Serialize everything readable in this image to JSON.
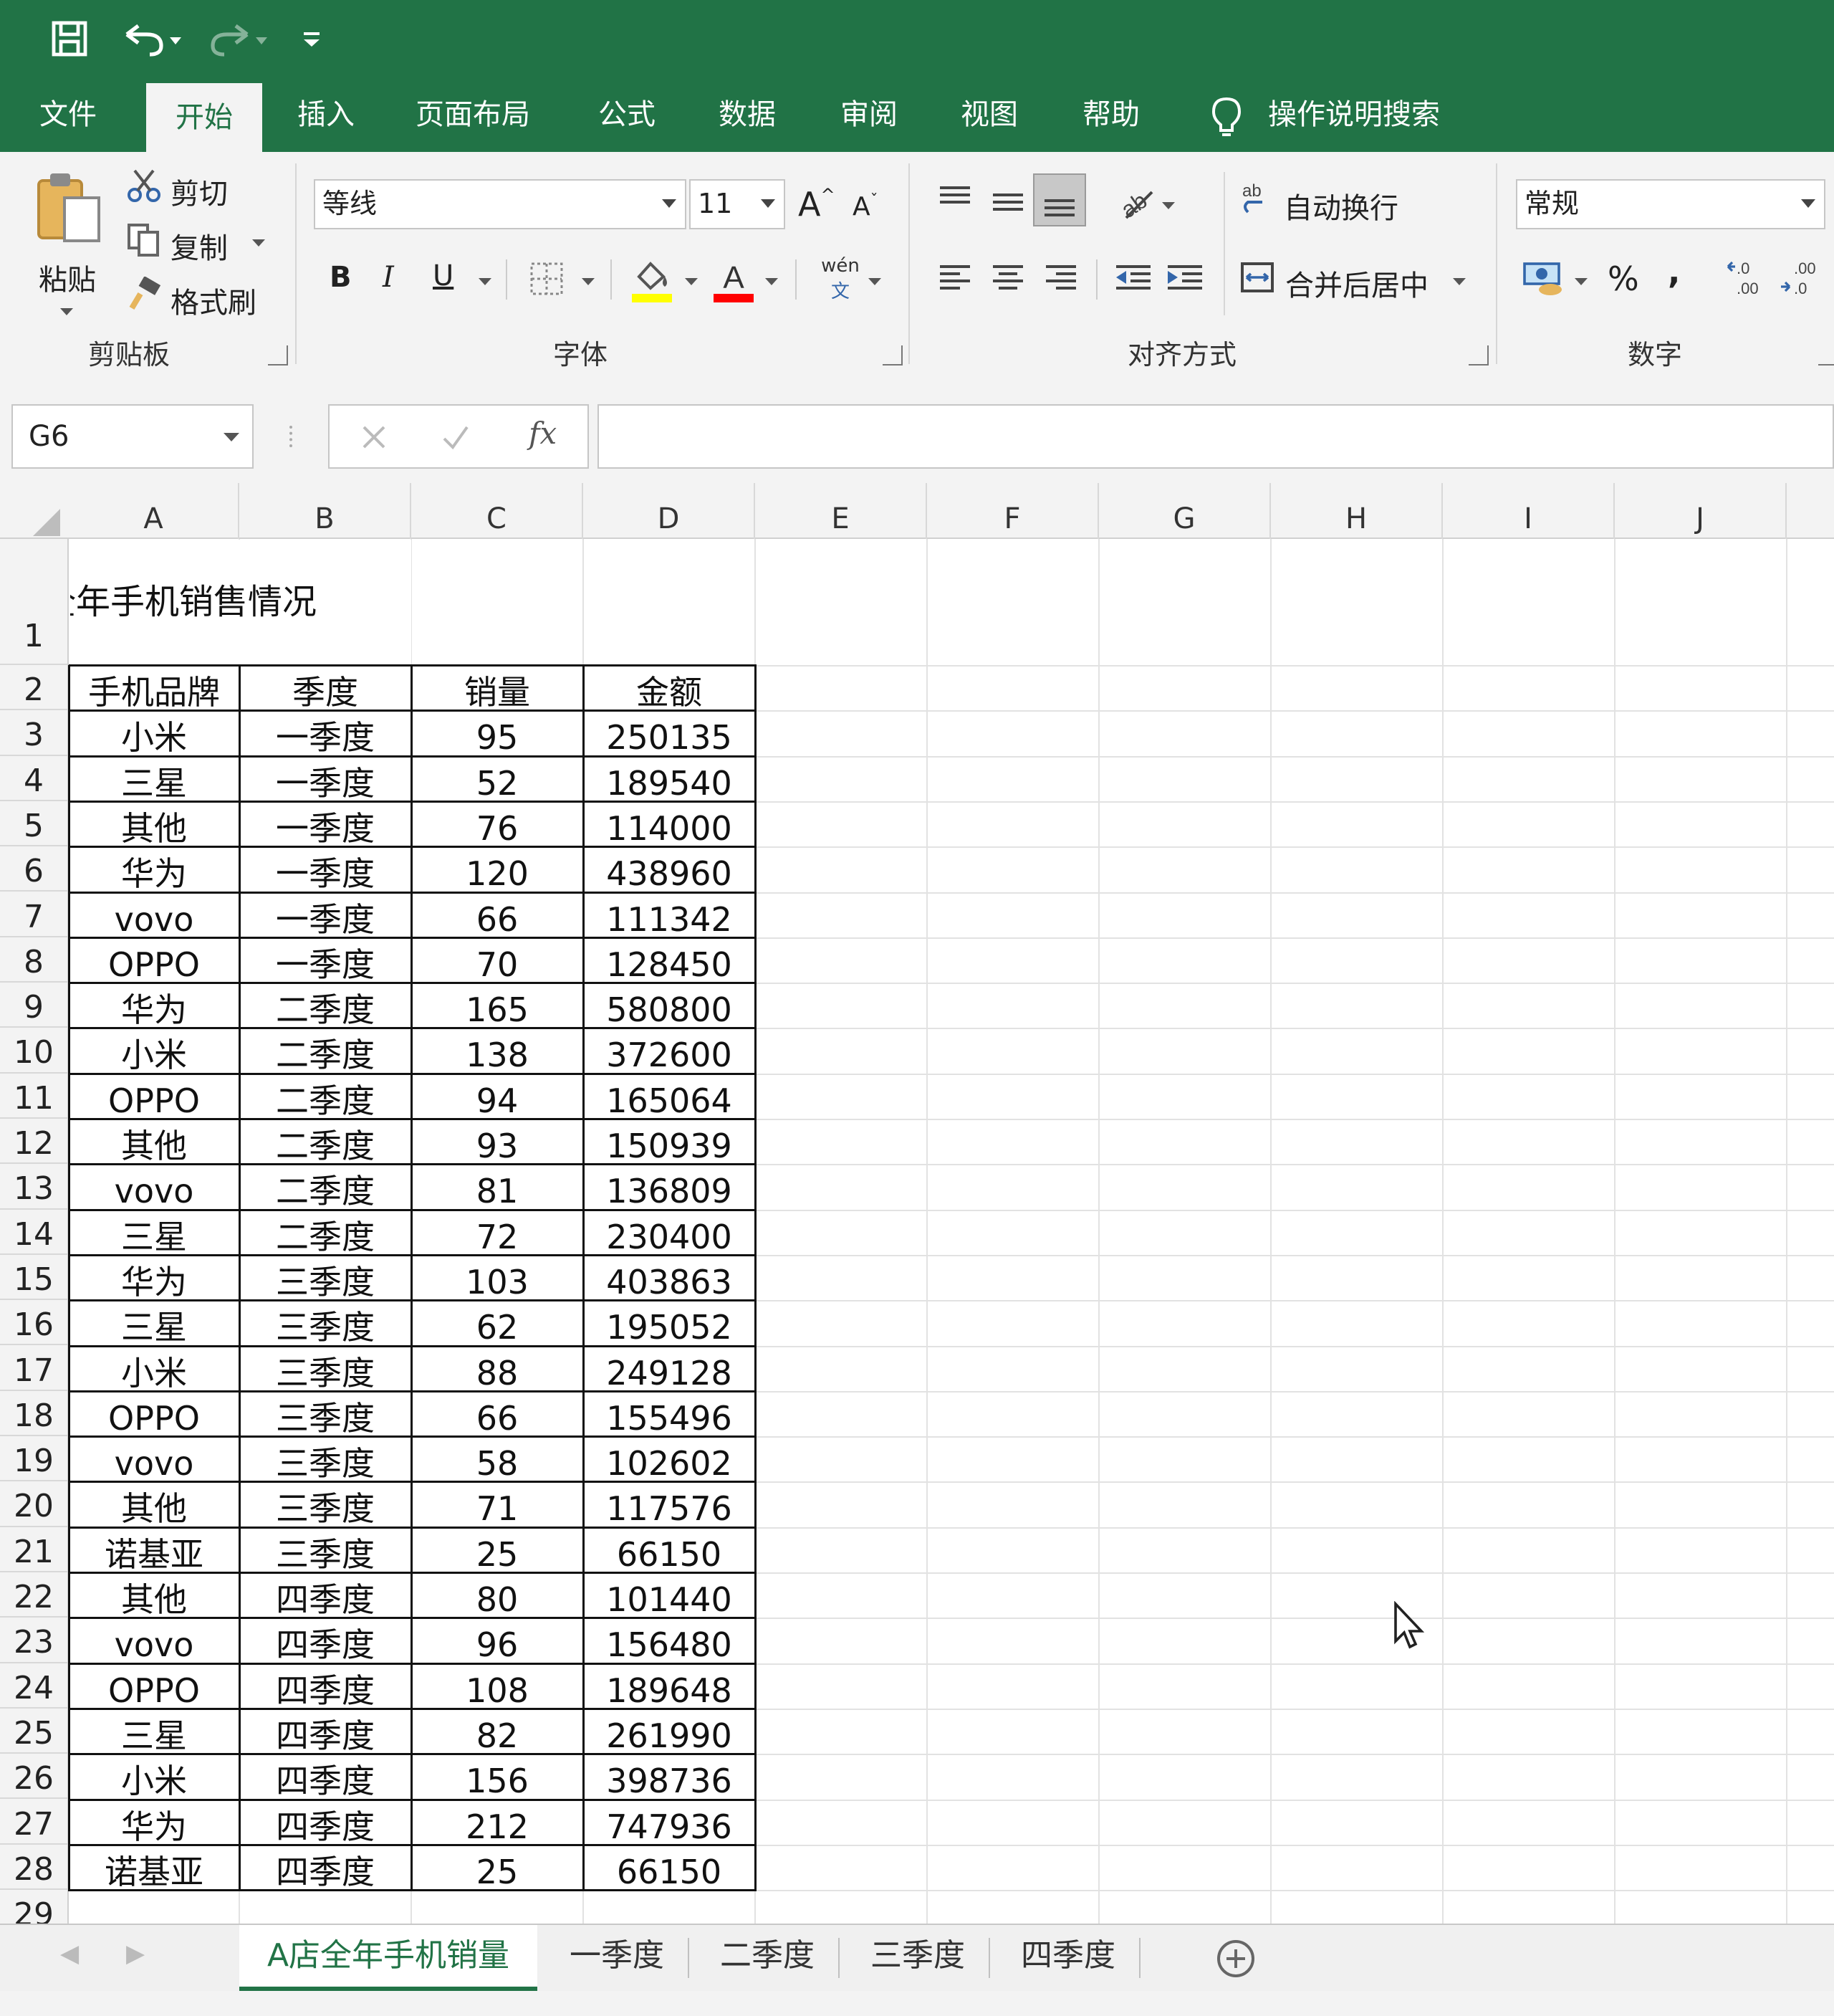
{
  "quick_access": {
    "save": "save-icon",
    "undo": "undo-icon",
    "redo": "redo-icon",
    "customize": "customize-icon"
  },
  "tabs": [
    {
      "label": "文件"
    },
    {
      "label": "开始"
    },
    {
      "label": "插入"
    },
    {
      "label": "页面布局"
    },
    {
      "label": "公式"
    },
    {
      "label": "数据"
    },
    {
      "label": "审阅"
    },
    {
      "label": "视图"
    },
    {
      "label": "帮助"
    },
    {
      "label": "操作说明搜索"
    }
  ],
  "ribbon": {
    "clipboard": {
      "paste": "粘贴",
      "cut": "剪切",
      "copy": "复制",
      "format_painter": "格式刷",
      "group": "剪贴板"
    },
    "font": {
      "name": "等线",
      "size": "11",
      "bold": "B",
      "italic": "I",
      "underline": "U",
      "phonetic": "wén",
      "phonetic2": "文",
      "group": "字体"
    },
    "alignment": {
      "wrap": "自动换行",
      "merge": "合并后居中",
      "group": "对齐方式"
    },
    "number": {
      "format": "常规",
      "percent": "%",
      "comma": ",",
      "inc": ".0→.00",
      "group": "数字"
    }
  },
  "formula_bar": {
    "name_box": "G6",
    "fx": "fx",
    "formula": ""
  },
  "columns": [
    "A",
    "B",
    "C",
    "D",
    "E",
    "F",
    "G",
    "H",
    "I",
    "J"
  ],
  "title_cell": "全年手机销售情况",
  "rows": [
    "1",
    "2",
    "3",
    "4",
    "5",
    "6",
    "7",
    "8",
    "9",
    "10",
    "11",
    "12",
    "13",
    "14",
    "15",
    "16",
    "17",
    "18",
    "19",
    "20",
    "21",
    "22",
    "23",
    "24",
    "25",
    "26",
    "27",
    "28",
    "29"
  ],
  "table": {
    "headers": [
      "手机品牌",
      "季度",
      "销量",
      "金额"
    ],
    "data": [
      [
        "小米",
        "一季度",
        "95",
        "250135"
      ],
      [
        "三星",
        "一季度",
        "52",
        "189540"
      ],
      [
        "其他",
        "一季度",
        "76",
        "114000"
      ],
      [
        "华为",
        "一季度",
        "120",
        "438960"
      ],
      [
        "vovo",
        "一季度",
        "66",
        "111342"
      ],
      [
        "OPPO",
        "一季度",
        "70",
        "128450"
      ],
      [
        "华为",
        "二季度",
        "165",
        "580800"
      ],
      [
        "小米",
        "二季度",
        "138",
        "372600"
      ],
      [
        "OPPO",
        "二季度",
        "94",
        "165064"
      ],
      [
        "其他",
        "二季度",
        "93",
        "150939"
      ],
      [
        "vovo",
        "二季度",
        "81",
        "136809"
      ],
      [
        "三星",
        "二季度",
        "72",
        "230400"
      ],
      [
        "华为",
        "三季度",
        "103",
        "403863"
      ],
      [
        "三星",
        "三季度",
        "62",
        "195052"
      ],
      [
        "小米",
        "三季度",
        "88",
        "249128"
      ],
      [
        "OPPO",
        "三季度",
        "66",
        "155496"
      ],
      [
        "vovo",
        "三季度",
        "58",
        "102602"
      ],
      [
        "其他",
        "三季度",
        "71",
        "117576"
      ],
      [
        "诺基亚",
        "三季度",
        "25",
        "66150"
      ],
      [
        "其他",
        "四季度",
        "80",
        "101440"
      ],
      [
        "vovo",
        "四季度",
        "96",
        "156480"
      ],
      [
        "OPPO",
        "四季度",
        "108",
        "189648"
      ],
      [
        "三星",
        "四季度",
        "82",
        "261990"
      ],
      [
        "小米",
        "四季度",
        "156",
        "398736"
      ],
      [
        "华为",
        "四季度",
        "212",
        "747936"
      ],
      [
        "诺基亚",
        "四季度",
        "25",
        "66150"
      ]
    ]
  },
  "sheets": [
    {
      "label": "A店全年手机销量",
      "active": true
    },
    {
      "label": "一季度"
    },
    {
      "label": "二季度"
    },
    {
      "label": "三季度"
    },
    {
      "label": "四季度"
    }
  ],
  "colors": {
    "accent": "#217346",
    "ribbon_bg": "#f3f3f3",
    "highlight": "#ffff00",
    "font_red": "#ff0000"
  }
}
